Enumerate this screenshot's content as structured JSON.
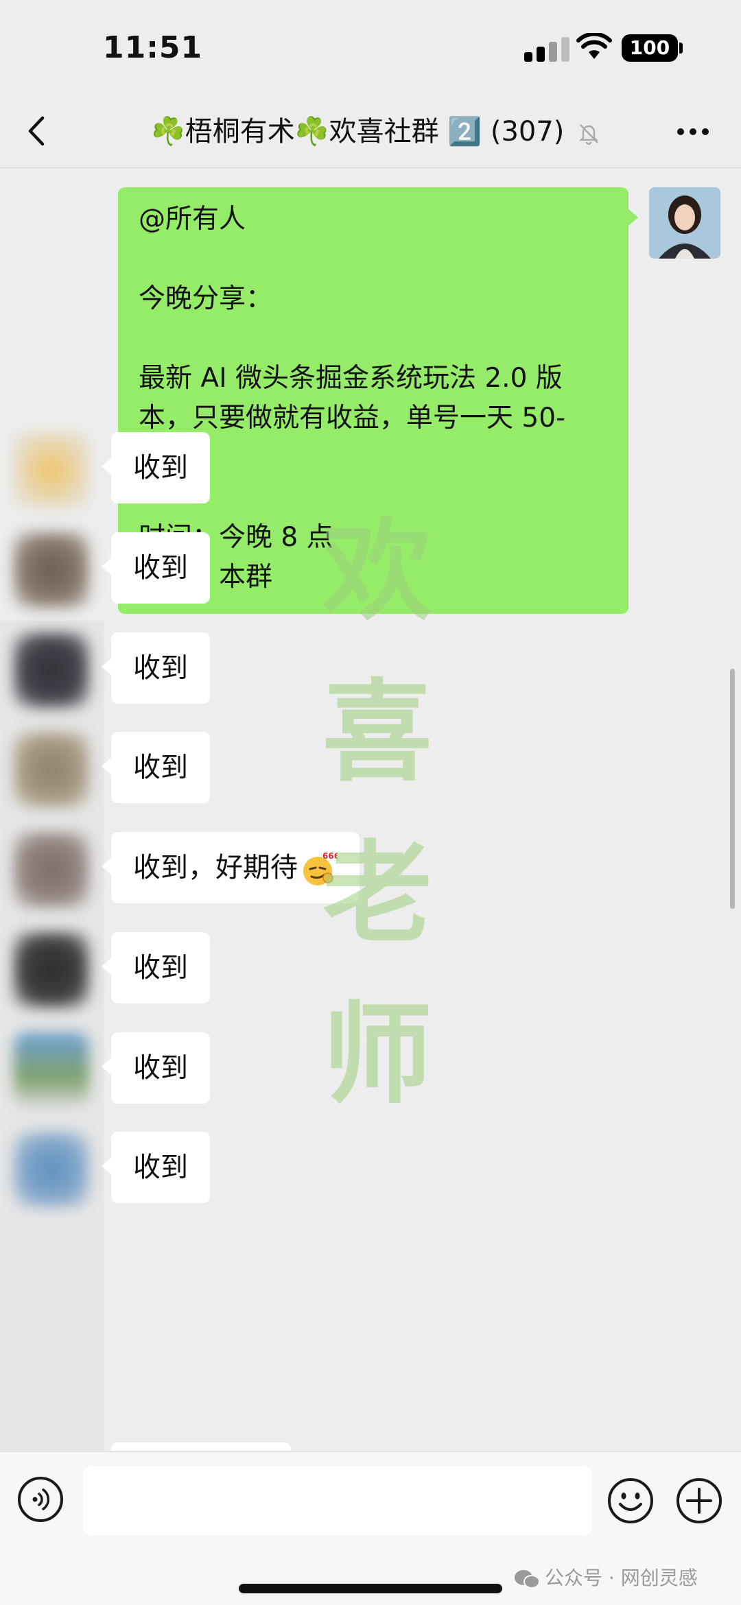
{
  "status_bar": {
    "time": "11:51",
    "battery": "100"
  },
  "nav": {
    "title": "☘️梧桐有术☘️欢喜社群 2️⃣ (307)"
  },
  "messages": {
    "announcement": "@所有人\n\n今晚分享：\n\n最新 AI 微头条掘金系统玩法 2.0 版本，只要做就有收益，单号一天 50-300！\n\n时间：今晚 8 点\n地点：本群",
    "replies": [
      "收到",
      "收到",
      "收到",
      "收到",
      "收到，好期待",
      "收到",
      "收到",
      "收到"
    ],
    "emoji_badge": "666"
  },
  "watermark": {
    "chars": [
      "欢",
      "喜",
      "老",
      "师"
    ]
  },
  "footer": {
    "credit": "公众号 · 网创灵感"
  },
  "colors": {
    "my_bubble": "#95ec69",
    "other_bubble": "#ffffff",
    "background": "#ededed"
  },
  "icons": [
    "back-icon",
    "mute-icon",
    "more-icon",
    "voice-icon",
    "emoji-icon",
    "plus-icon",
    "wifi-icon",
    "signal-icon",
    "wechat-icon"
  ]
}
